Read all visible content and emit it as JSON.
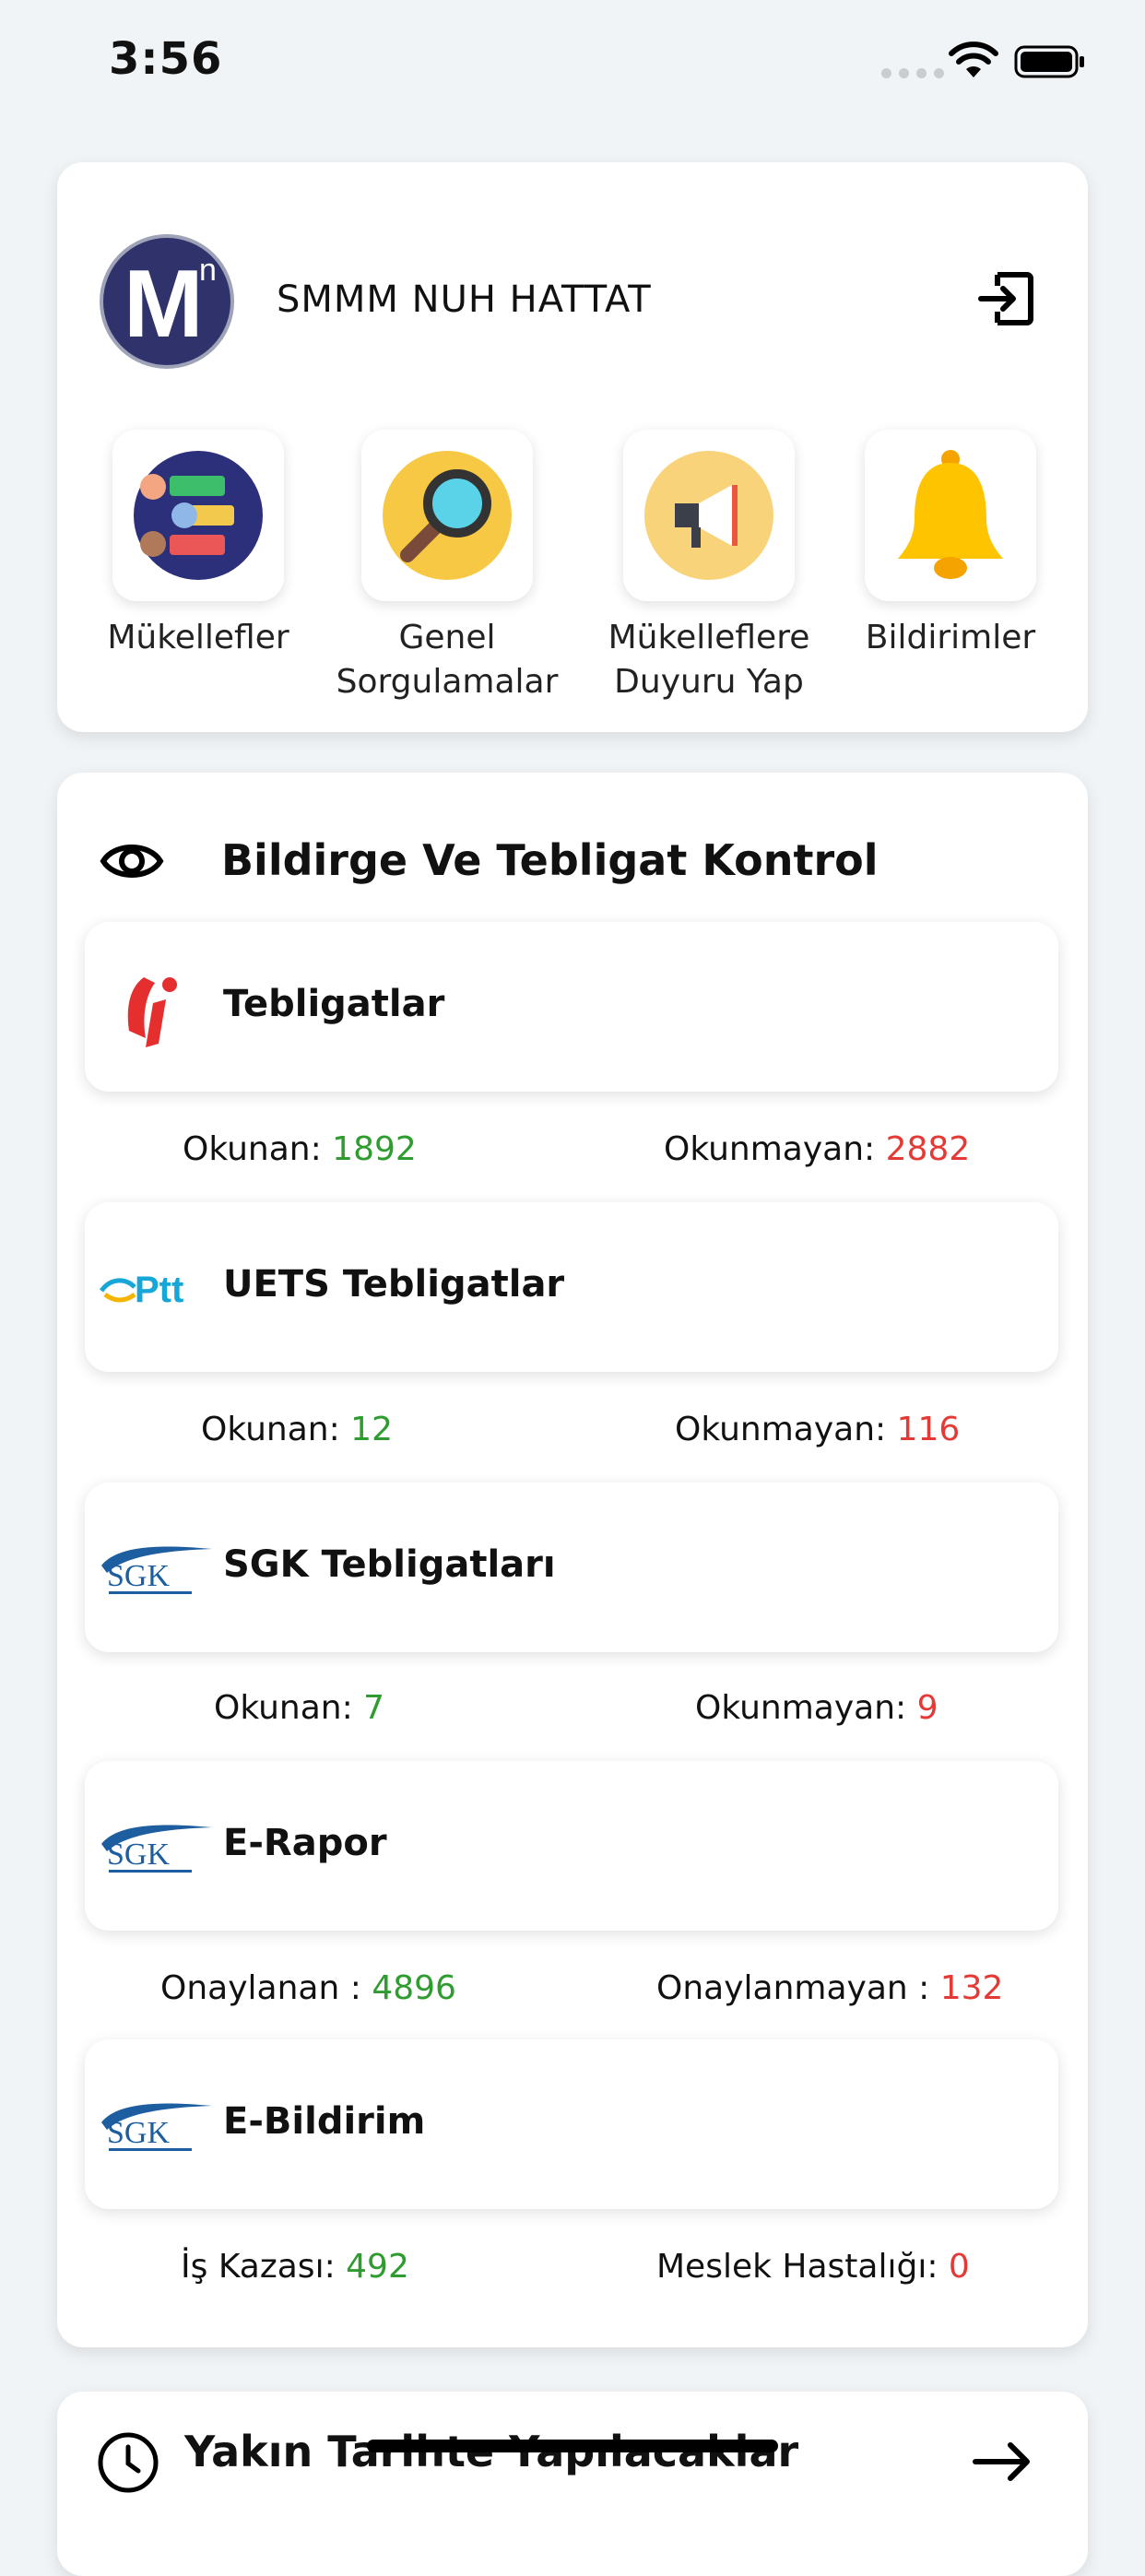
{
  "status_bar": {
    "time": "3:56"
  },
  "header": {
    "user_name": "SMMM NUH HATTAT",
    "avatar_letter": "M",
    "avatar_superscript": "n"
  },
  "quick_actions": [
    {
      "label": "Mükellefler",
      "icon": "taxpayers-icon"
    },
    {
      "label": "Genel\nSorgulamalar",
      "icon": "magnifier-icon"
    },
    {
      "label": "Mükelleflere\nDuyuru Yap",
      "icon": "megaphone-icon"
    },
    {
      "label": "Bildirimler",
      "icon": "bell-icon"
    }
  ],
  "control_section": {
    "title": "Bildirge Ve Tebligat Kontrol",
    "items": [
      {
        "label": "Tebligatlar",
        "logo": "gib-logo",
        "left_label": "Okunan:",
        "left_value": "1892",
        "right_label": "Okunmayan:",
        "right_value": "2882"
      },
      {
        "label": "UETS Tebligatlar",
        "logo": "ptt-logo",
        "logo_text": "Ptt",
        "left_label": "Okunan:",
        "left_value": "12",
        "right_label": "Okunmayan:",
        "right_value": "116"
      },
      {
        "label": "SGK Tebligatları",
        "logo": "sgk-logo",
        "logo_text": "SGK",
        "left_label": "Okunan:",
        "left_value": "7",
        "right_label": "Okunmayan:",
        "right_value": "9"
      },
      {
        "label": "E-Rapor",
        "logo": "sgk-logo",
        "logo_text": "SGK",
        "left_label": "Onaylanan :",
        "left_value": "4896",
        "right_label": "Onaylanmayan :",
        "right_value": "132"
      },
      {
        "label": "E-Bildirim",
        "logo": "sgk-logo",
        "logo_text": "SGK",
        "left_label": "İş Kazası:",
        "left_value": "492",
        "right_label": "Meslek Hastalığı:",
        "right_value": "0"
      }
    ]
  },
  "upcoming_section": {
    "title": "Yakın Tarihte Yapılacaklar"
  },
  "colors": {
    "positive": "#2E9C2E",
    "negative": "#E53935",
    "background": "#F1F4F6"
  }
}
